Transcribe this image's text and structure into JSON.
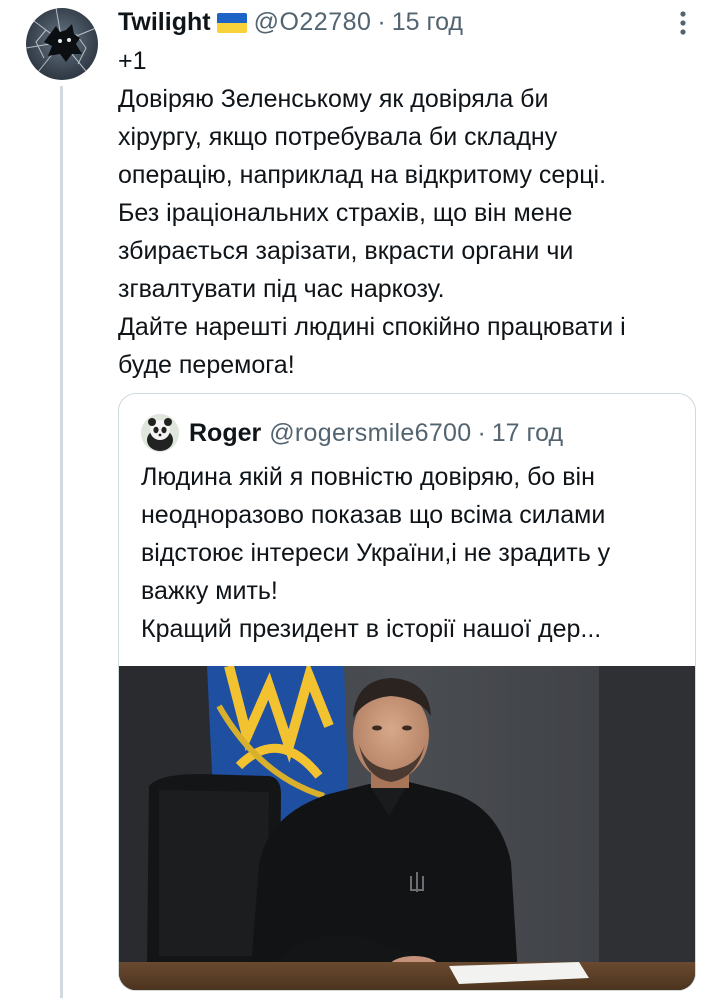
{
  "tweet": {
    "author_name": "Twilight",
    "flag_icon": "ukraine-flag",
    "handle": "@O22780",
    "separator": "·",
    "time": "15 год",
    "lines": [
      "+1",
      "Довіряю Зеленському як довіряла би",
      "хірургу, якщо потребувала би складну",
      "операцію, наприклад на відкритому серці.",
      "Без іраціональних страхів, що він мене",
      "збирається зарізати, вкрасти органи чи",
      "згвалтувати під час наркозу.",
      "Дайте нарешті людині спокійно працювати і",
      "буде перемога!"
    ]
  },
  "quoted": {
    "author_name": "Roger",
    "handle": "@rogersmile6700",
    "separator": "·",
    "time": "17 год",
    "lines": [
      "Людина якій я повністю довіряю, бо він",
      "неодноразово показав що всіма силами",
      "відстоює інтереси України,і не зрадить у",
      "важку мить!",
      "Кращий президент в історії нашої дер..."
    ]
  },
  "colors": {
    "text": "#0f1419",
    "secondary": "#536471",
    "border": "#cfd9de",
    "flag_blue": "#1e63c6",
    "flag_yellow": "#f8d238"
  }
}
